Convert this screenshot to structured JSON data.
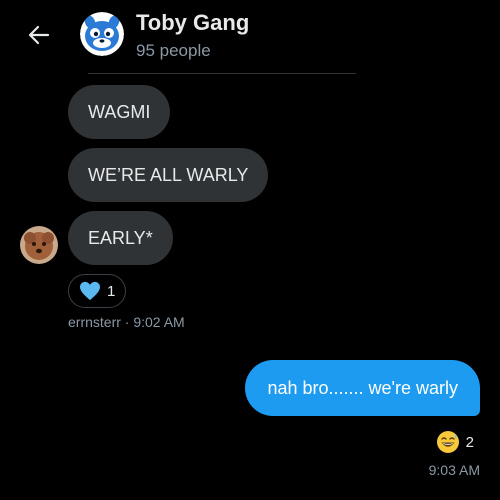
{
  "header": {
    "back_icon": "arrow-left-icon",
    "group_name": "Toby Gang",
    "member_count": "95 people",
    "avatar_icon": "blue-cartoon-creature-avatar"
  },
  "messages_in": [
    {
      "text": "WAGMI"
    },
    {
      "text": "WE’RE ALL WARLY"
    },
    {
      "text": "EARLY*"
    }
  ],
  "incoming_group": {
    "sender_avatar": "dog-photo-avatar",
    "reaction": {
      "emoji_icon": "blue-heart-icon",
      "count": "1"
    },
    "meta": "errnsterr · 9:02 AM"
  },
  "message_out": {
    "text": "nah bro....... we're warly",
    "reaction": {
      "emoji_icon": "grinning-sweat-emoji-icon",
      "count": "2"
    },
    "meta": "9:03 AM"
  },
  "colors": {
    "background": "#000000",
    "incoming_bubble": "#2f3336",
    "outgoing_bubble": "#1d9bf0",
    "muted_text": "#8b98a5"
  }
}
